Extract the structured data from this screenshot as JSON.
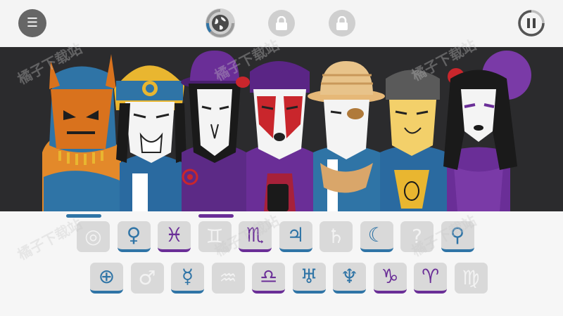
{
  "toolbar": {
    "menu_icon": "menu-icon",
    "globe_icon": "globe-icon",
    "lock_icon": "lock-icon",
    "pause_icon": "pause-icon"
  },
  "colors": {
    "blue": "#2f74a6",
    "purple": "#6a2e97",
    "slot_bg": "#d9d9d9",
    "stage_bg": "#2b2b2d"
  },
  "characters": [
    {
      "name": "character-1",
      "hat": "horned-helmet"
    },
    {
      "name": "character-2",
      "hat": "sun-turban"
    },
    {
      "name": "character-3",
      "hat": "purple-bowler"
    },
    {
      "name": "character-4",
      "hat": "purple-bandana"
    },
    {
      "name": "character-5",
      "hat": "straw-hat"
    },
    {
      "name": "character-6",
      "hat": "grey-beanie"
    },
    {
      "name": "character-7",
      "hat": "purple-beret"
    }
  ],
  "sound_rows": [
    [
      {
        "glyph": "◎",
        "state": "empty",
        "name": "slot-target"
      },
      {
        "glyph": "♀",
        "state": "blue",
        "name": "slot-venus"
      },
      {
        "glyph": "♓",
        "state": "purple",
        "name": "slot-pisces"
      },
      {
        "glyph": "♊",
        "state": "empty",
        "name": "slot-gemini"
      },
      {
        "glyph": "♏",
        "state": "purple",
        "name": "slot-scorpio"
      },
      {
        "glyph": "♃",
        "state": "blue",
        "name": "slot-jupiter"
      },
      {
        "glyph": "♄",
        "state": "empty",
        "name": "slot-saturn"
      },
      {
        "glyph": "☾",
        "state": "blue",
        "name": "slot-moon"
      },
      {
        "glyph": "?",
        "state": "empty",
        "name": "slot-unknown"
      },
      {
        "glyph": "⚲",
        "state": "blue",
        "name": "slot-ceres"
      }
    ],
    [
      {
        "glyph": "⊕",
        "state": "blue",
        "name": "slot-earth"
      },
      {
        "glyph": "♂",
        "state": "empty",
        "name": "slot-mars"
      },
      {
        "glyph": "☿",
        "state": "blue",
        "name": "slot-mercury"
      },
      {
        "glyph": "♒",
        "state": "empty",
        "name": "slot-aquarius"
      },
      {
        "glyph": "♎",
        "state": "purple",
        "name": "slot-libra"
      },
      {
        "glyph": "♅",
        "state": "blue",
        "name": "slot-uranus"
      },
      {
        "glyph": "♆",
        "state": "blue",
        "name": "slot-neptune"
      },
      {
        "glyph": "♑",
        "state": "purple",
        "name": "slot-capricorn"
      },
      {
        "glyph": "♈",
        "state": "purple",
        "name": "slot-aries"
      },
      {
        "glyph": "♍",
        "state": "empty",
        "name": "slot-virgo"
      }
    ]
  ],
  "watermark_text": "橘子下载站"
}
